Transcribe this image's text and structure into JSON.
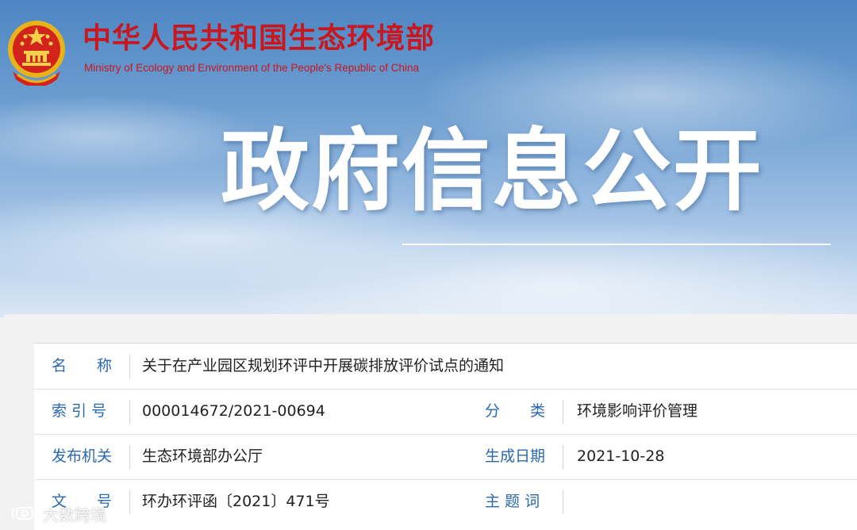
{
  "header": {
    "ministry_cn": "中华人民共和国生态环境部",
    "ministry_en": "Ministry of Ecology and Environment of the People's Republic of China",
    "section_title": "政府信息公开"
  },
  "info_rows": [
    {
      "label": "名　　称",
      "value": "关于在产业园区规划环评中开展碳排放评价试点的通知"
    },
    {
      "label": "索 引 号",
      "value": "000014672/2021-00694",
      "label2": "分　　类",
      "value2": "环境影响评价管理"
    },
    {
      "label": "发布机关",
      "value": "生态环境部办公厅",
      "label2": "生成日期",
      "value2": "2021-10-28"
    },
    {
      "label": "文　　号",
      "value": "环办环评函〔2021〕471号",
      "label2": "主 题 词",
      "value2": ""
    }
  ],
  "watermark": {
    "text": "大数跨境"
  },
  "colors": {
    "ministry_red": "#c8171e",
    "label_blue": "#2a69ad",
    "banner_blue": "#4d86c3"
  },
  "icons": {
    "emblem": "national-emblem-icon",
    "watermark": "camera-logo-icon"
  }
}
